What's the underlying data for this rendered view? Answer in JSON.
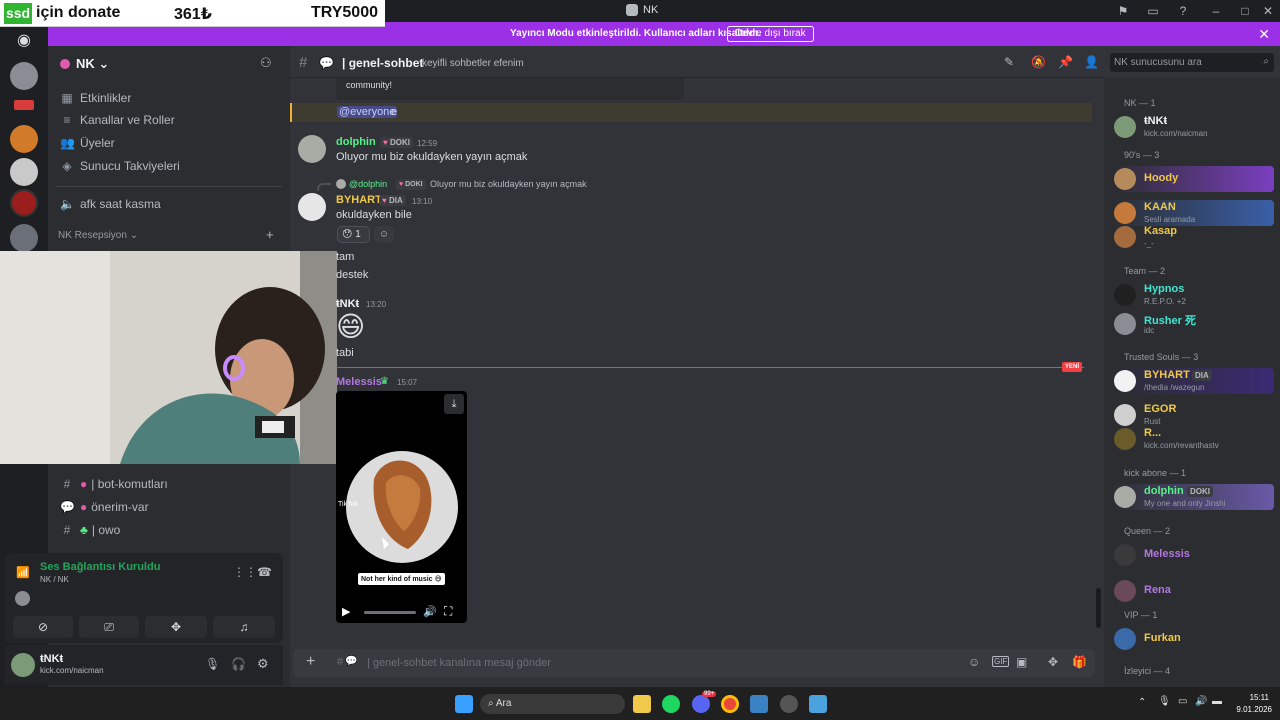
{
  "window": {
    "title": "NK"
  },
  "donate": {
    "tag": "ssd",
    "text": "için donate",
    "amount1": "361₺",
    "amount2": "TRY5000"
  },
  "banner": {
    "text": "Yayıncı Modu etkinleştirildi. Kullanıcı adları kısaltıldı.",
    "button": "Devre dışı bırak"
  },
  "server": {
    "name": "NK"
  },
  "sidebar": {
    "items": [
      {
        "label": "Etkinlikler",
        "icon": "calendar-icon"
      },
      {
        "label": "Kanallar ve Roller",
        "icon": "list-icon"
      },
      {
        "label": "Üyeler",
        "icon": "people-icon"
      },
      {
        "label": "Sunucu Takviyeleri",
        "icon": "boost-icon"
      }
    ],
    "voice_channel": "afk saat kasma",
    "category": "NK Resepsiyon",
    "channels": [
      "| bot-komutları",
      "önerim-var",
      "| owo"
    ]
  },
  "voice": {
    "status": "Ses Bağlantısı Kuruldu",
    "location": "NK / NK"
  },
  "user": {
    "name": "ŧNKŧ",
    "status": "kick.com/naicman"
  },
  "chat": {
    "channel": "| genel-sohbet",
    "topic": "keyifli sohbetler efenim",
    "embed_fragment": "community!",
    "mention": "@everyone",
    "mention_suffix": "e",
    "new_label": "YENİ",
    "messages": [
      {
        "author": "dolphin",
        "badge": "DOKI",
        "time": "12:59",
        "text": "Oluyor mu biz okuldayken yayın açmak"
      },
      {
        "reply_author": "@dolphin",
        "reply_badge": "DOKI",
        "reply_text": "Oluyor mu biz okuldayken yayın açmak",
        "author": "BYHART",
        "badge": "DIA",
        "time": "13:10",
        "text": "okuldayken bile",
        "reaction_count": "1"
      },
      {
        "text": "tam"
      },
      {
        "text": "destek"
      },
      {
        "author": "ŧNKŧ",
        "time": "13:20",
        "emoji": "😄",
        "text": "tabi"
      },
      {
        "author": "Melessis",
        "time": "15:07",
        "video_caption": "Not her kind of music 😅",
        "tiktok": "TikTok"
      }
    ]
  },
  "search": {
    "placeholder": "NK sunucusunu ara"
  },
  "composer": {
    "placeholder": "| genel-sohbet kanalına mesaj gönder"
  },
  "members": {
    "groups": [
      {
        "title": "NK — 1",
        "members": [
          {
            "name": "ŧNKŧ",
            "sub": "kick.com/naicman",
            "color": "#f2f3f5"
          }
        ]
      },
      {
        "title": "90's — 3",
        "members": [
          {
            "name": "Hoody",
            "sub": "",
            "color": "#f0c94b"
          },
          {
            "name": "KAAN",
            "sub": "Sesli aramada",
            "color": "#f0c94b"
          },
          {
            "name": "Kasap",
            "sub": "-_-",
            "color": "#f0c94b"
          }
        ]
      },
      {
        "title": "Team — 2",
        "members": [
          {
            "name": "Hypnos",
            "sub": "R.E.P.O. +2",
            "color": "#3ee5d3"
          },
          {
            "name": "Rusher 死",
            "sub": "idc",
            "color": "#3ee5d3"
          }
        ]
      },
      {
        "title": "Trusted Souls — 3",
        "members": [
          {
            "name": "BYHART",
            "badge": "DIA",
            "sub": "/thedia /wazegun",
            "color": "#f0c94b"
          },
          {
            "name": "EGOR",
            "sub": "Rust",
            "color": "#f0c94b"
          },
          {
            "name": "R...",
            "sub": "kick.com/revanthastv",
            "color": "#f0c94b"
          }
        ]
      },
      {
        "title": "kick abone — 1",
        "members": [
          {
            "name": "dolphin",
            "badge": "DOKI",
            "sub": "My one and only Jinshi",
            "color": "#57f287"
          }
        ]
      },
      {
        "title": "Queen — 2",
        "members": [
          {
            "name": "Melessis",
            "sub": "",
            "color": "#b377e0"
          },
          {
            "name": "Rena",
            "sub": "",
            "color": "#b377e0"
          }
        ]
      },
      {
        "title": "VIP — 1",
        "members": [
          {
            "name": "Furkan",
            "sub": "",
            "color": "#f0c94b"
          }
        ]
      },
      {
        "title": "İzleyici — 4",
        "members": []
      }
    ]
  },
  "taskbar": {
    "search": "Ara",
    "time": "15:11",
    "date": "9.01.2026",
    "notif": "99+"
  }
}
